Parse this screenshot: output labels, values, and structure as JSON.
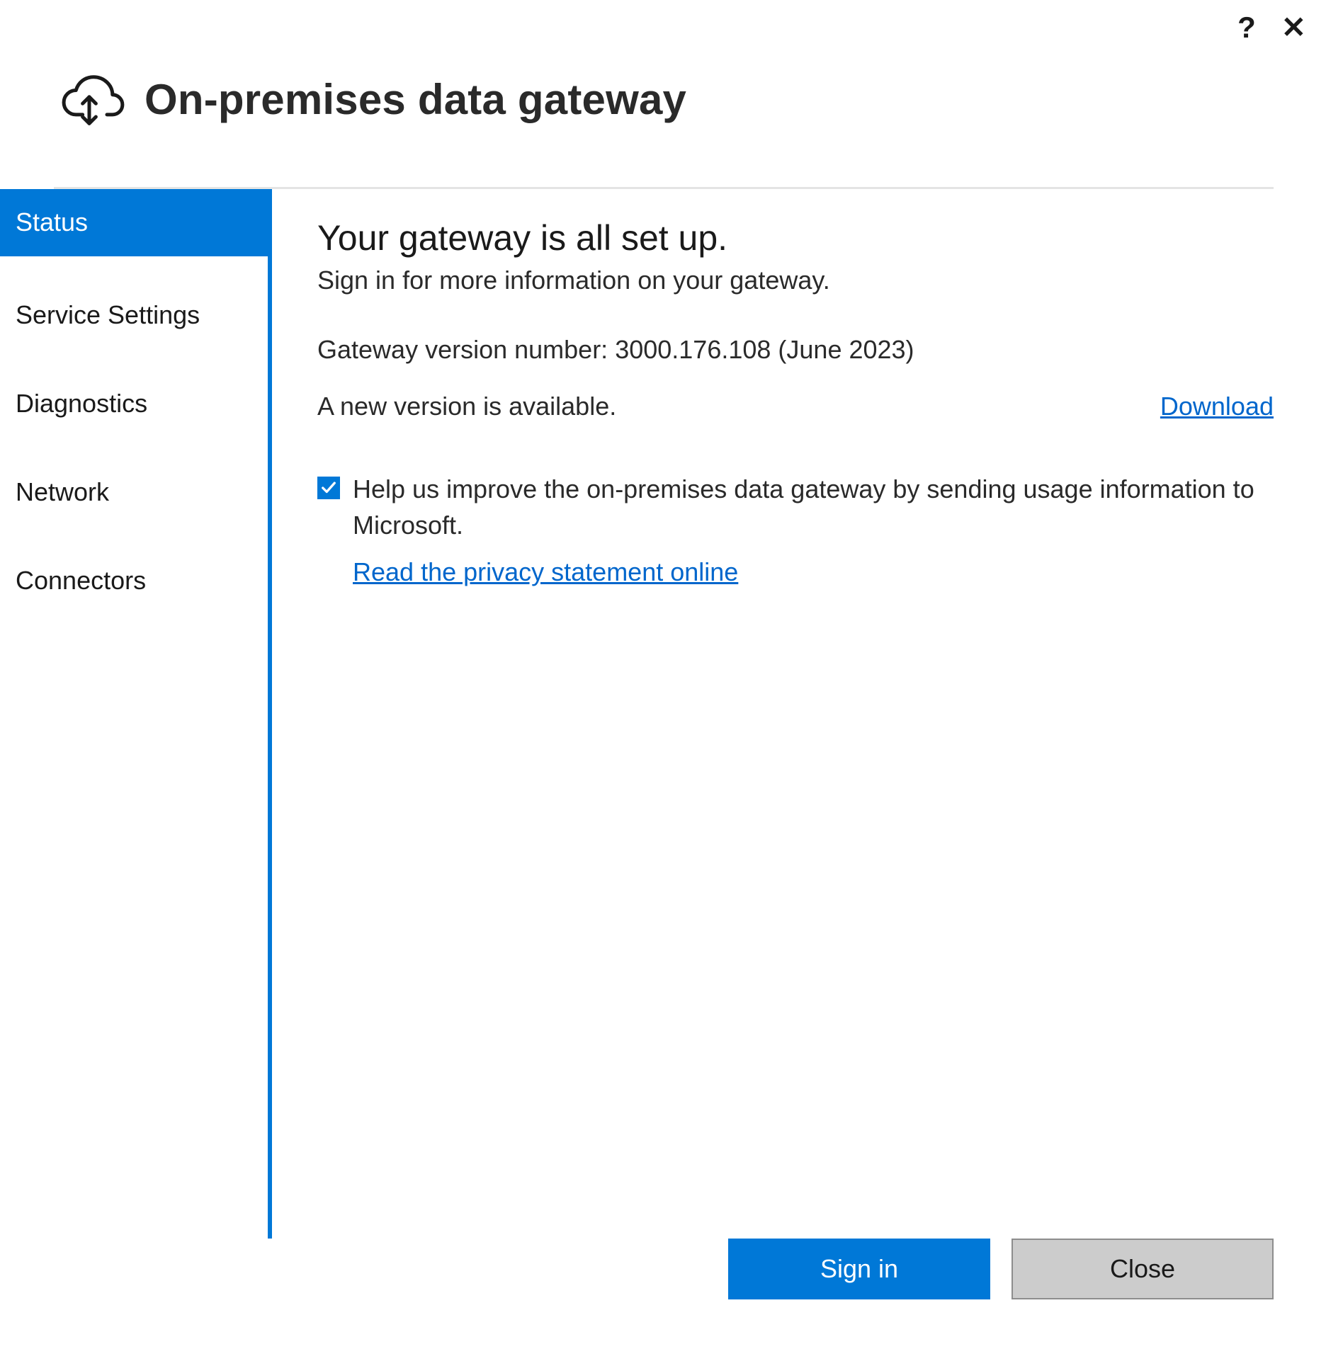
{
  "window": {
    "title": "On-premises data gateway"
  },
  "sidebar": {
    "items": [
      {
        "label": "Status",
        "active": true
      },
      {
        "label": "Service Settings",
        "active": false
      },
      {
        "label": "Diagnostics",
        "active": false
      },
      {
        "label": "Network",
        "active": false
      },
      {
        "label": "Connectors",
        "active": false
      }
    ]
  },
  "main": {
    "heading": "Your gateway is all set up.",
    "sub": "Sign in for more information on your gateway.",
    "version_line": "Gateway version number: 3000.176.108 (June 2023)",
    "new_version_text": "A new version is available.",
    "download_label": "Download",
    "consent_text": "Help us improve the on-premises data gateway by sending usage information to Microsoft.",
    "consent_checked": true,
    "privacy_label": "Read the privacy statement online"
  },
  "footer": {
    "primary": "Sign in",
    "secondary": "Close"
  }
}
